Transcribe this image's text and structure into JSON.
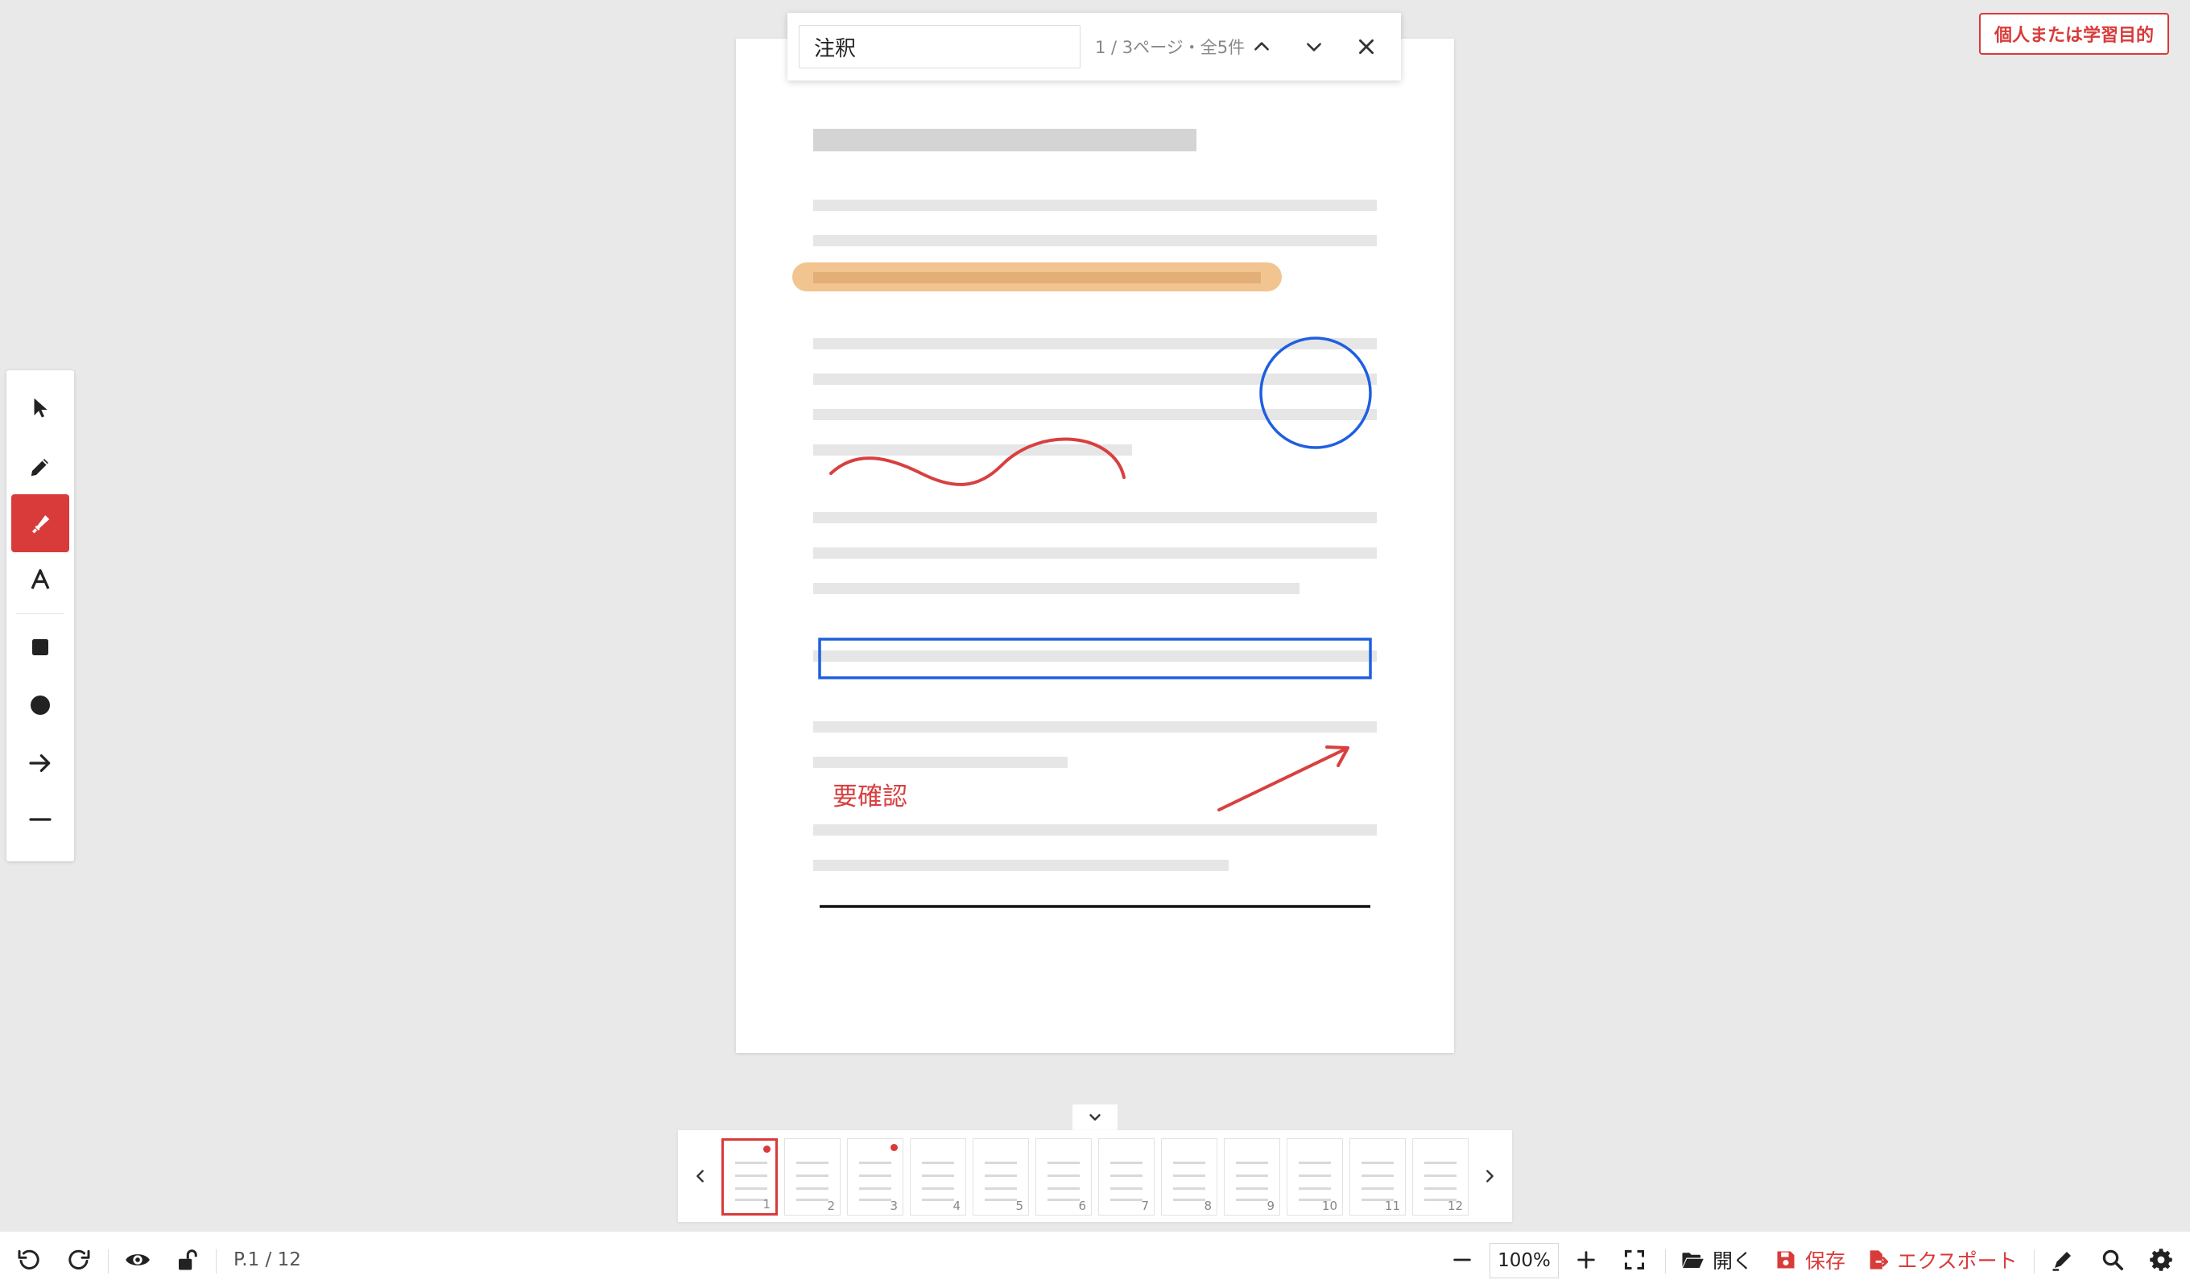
{
  "license_badge": "個人または学習目的",
  "search": {
    "value": "注釈",
    "result_count": "1 / 3ページ・全5件",
    "prev_icon": "chevron-up-icon",
    "next_icon": "chevron-down-icon",
    "close_icon": "close-icon"
  },
  "document": {
    "annotation_text": "要確認",
    "highlight_color": "#f2c490",
    "pen_color": "#d84040",
    "shape_color": "#1f5fe0"
  },
  "toolbar": {
    "tools": [
      {
        "name": "select",
        "icon": "cursor-arrow-icon",
        "active": false
      },
      {
        "name": "pen",
        "icon": "pencil-icon",
        "active": false
      },
      {
        "name": "highlighter",
        "icon": "highlighter-icon",
        "active": true
      },
      {
        "name": "text",
        "icon": "text-a-icon",
        "active": false
      },
      {
        "name": "rectangle",
        "icon": "square-icon",
        "active": false
      },
      {
        "name": "ellipse",
        "icon": "circle-icon",
        "active": false
      },
      {
        "name": "arrow",
        "icon": "arrow-right-icon",
        "active": false
      },
      {
        "name": "line",
        "icon": "line-icon",
        "active": false
      }
    ],
    "accent": "#d93a3a"
  },
  "thumbnails": {
    "pages": [
      {
        "num": "1",
        "active": true,
        "marked": true
      },
      {
        "num": "2",
        "active": false,
        "marked": false
      },
      {
        "num": "3",
        "active": false,
        "marked": true
      },
      {
        "num": "4",
        "active": false,
        "marked": false
      },
      {
        "num": "5",
        "active": false,
        "marked": false
      },
      {
        "num": "6",
        "active": false,
        "marked": false
      },
      {
        "num": "7",
        "active": false,
        "marked": false
      },
      {
        "num": "8",
        "active": false,
        "marked": false
      },
      {
        "num": "9",
        "active": false,
        "marked": false
      },
      {
        "num": "10",
        "active": false,
        "marked": false
      },
      {
        "num": "11",
        "active": false,
        "marked": false
      },
      {
        "num": "12",
        "active": false,
        "marked": false
      }
    ]
  },
  "bottombar": {
    "page_indicator": "P.1 / 12",
    "zoom": "100%",
    "open_label": "開く",
    "save_label": "保存",
    "export_label": "エクスポート"
  }
}
